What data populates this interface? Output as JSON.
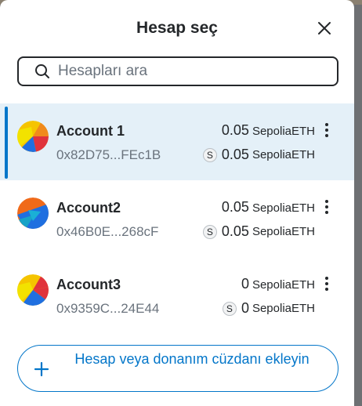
{
  "modal": {
    "title": "Hesap seç",
    "close_icon": "close-icon"
  },
  "search": {
    "placeholder": "Hesapları ara",
    "value": ""
  },
  "accounts": [
    {
      "name": "Account 1",
      "address": "0x82D75...FEc1B",
      "balance": "0.05",
      "unit": "SepoliaETH",
      "secondary_badge": "S",
      "secondary_balance": "0.05",
      "secondary_unit": "SepoliaETH",
      "selected": true
    },
    {
      "name": "Account2",
      "address": "0x46B0E...268cF",
      "balance": "0.05",
      "unit": "SepoliaETH",
      "secondary_badge": "S",
      "secondary_balance": "0.05",
      "secondary_unit": "SepoliaETH",
      "selected": false
    },
    {
      "name": "Account3",
      "address": "0x9359C...24E44",
      "balance": "0",
      "unit": "SepoliaETH",
      "secondary_badge": "S",
      "secondary_balance": "0",
      "secondary_unit": "SepoliaETH",
      "selected": false
    }
  ],
  "add_button": {
    "label": "Hesap veya donanım cüzdanı ekleyin",
    "icon": "plus-icon"
  },
  "colors": {
    "accent": "#0376c9",
    "selected_bg": "#e4f0f8",
    "text_primary": "#24272a",
    "text_muted": "#6a737d"
  }
}
